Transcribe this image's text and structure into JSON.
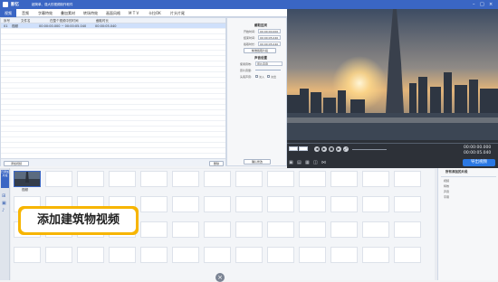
{
  "titlebar": {
    "app": "影忆",
    "subtitle": "超简单、强大的视频制作软件"
  },
  "menu": [
    "视频",
    "音频",
    "字幕特效",
    "叠加素材",
    "转场特效",
    "画面风格",
    "M T V",
    "卡拉OK",
    "片头片尾"
  ],
  "table": {
    "headers": [
      "序号",
      "文件名",
      "在整个视频中的时间",
      "截取时长"
    ],
    "rows": [
      {
        "index": "01",
        "name": "视频",
        "time": "00:00:00.000 ~ 00:00:05.040",
        "duration": "00:00:05.040"
      }
    ],
    "add_button": "添加视频",
    "delete_button": "删除"
  },
  "settings": {
    "clip_title": "截取区间",
    "start_label": "开始时间:",
    "start_value": "00:00:00.000",
    "end_label": "结束时间:",
    "end_value": "00:00:05.040",
    "dur_label": "截取时长:",
    "dur_value": "00:00:05.040",
    "precise_button": "精准截取片段",
    "sound_title": "声音设置",
    "speed_label": "使用音效:",
    "speed_value": "原片声音",
    "voice_label": "原片音量:",
    "fade_label": "头尾声音:",
    "fade_in": "淡入",
    "fade_out": "淡出",
    "confirm_button": "确认修改"
  },
  "player": {
    "time_current": "00:00:00.000",
    "time_total": "00:00:05.040",
    "export_button": "导出视频"
  },
  "timeline": {
    "clip_label": "视频",
    "side_tabs": [
      "已添加片段"
    ]
  },
  "right_panel": {
    "title": "所有添加的片段",
    "items": [
      "视频",
      "特效",
      "声音",
      "字幕"
    ]
  },
  "callout": "添加建筑物视频"
}
